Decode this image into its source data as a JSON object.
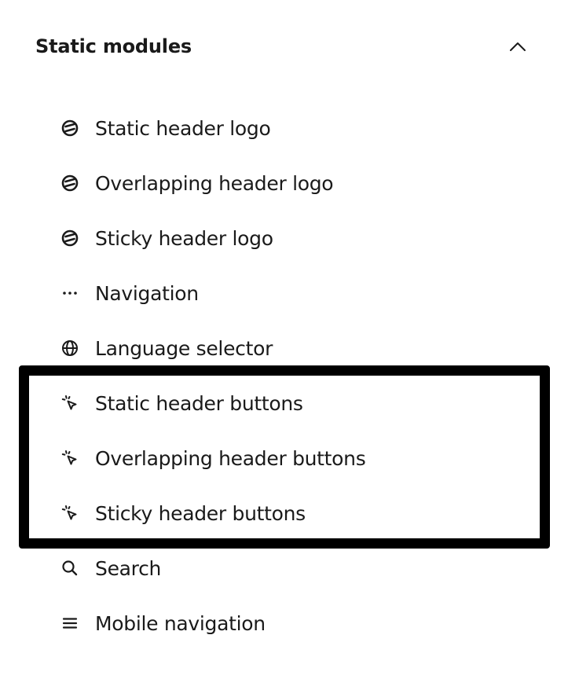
{
  "section": {
    "title": "Static modules",
    "chevron_icon": "chevron-up-icon"
  },
  "modules": [
    {
      "label": "Static header logo",
      "icon": "logo-icon"
    },
    {
      "label": "Overlapping header logo",
      "icon": "logo-icon"
    },
    {
      "label": "Sticky header logo",
      "icon": "logo-icon"
    },
    {
      "label": "Navigation",
      "icon": "more-horizontal-icon"
    },
    {
      "label": "Language selector",
      "icon": "globe-icon"
    },
    {
      "label": "Static header buttons",
      "icon": "cursor-click-icon"
    },
    {
      "label": "Overlapping header buttons",
      "icon": "cursor-click-icon"
    },
    {
      "label": "Sticky header buttons",
      "icon": "cursor-click-icon"
    },
    {
      "label": "Search",
      "icon": "search-icon"
    },
    {
      "label": "Mobile navigation",
      "icon": "menu-icon"
    }
  ],
  "colors": {
    "text": "#1a1a1a",
    "highlight_border": "#000000",
    "background": "#ffffff"
  }
}
